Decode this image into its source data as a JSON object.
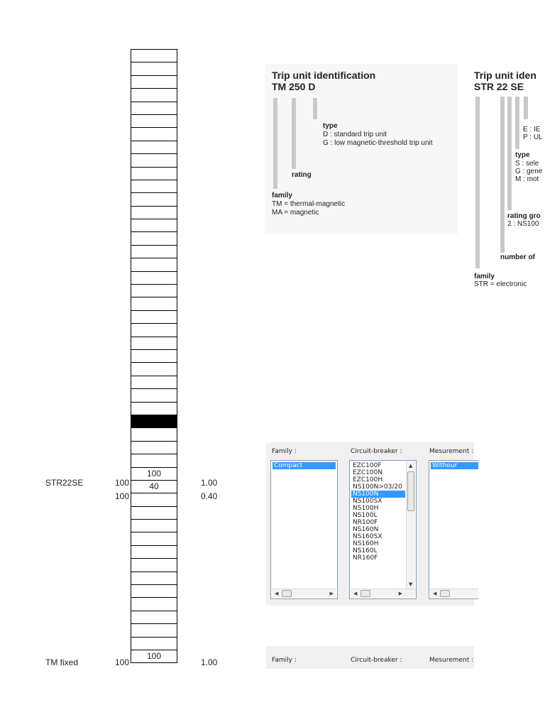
{
  "grid": {
    "rows": [
      {
        "label": "STR22SE",
        "left": "100",
        "cell": "100",
        "right": "1.00"
      },
      {
        "label": "",
        "left": "100",
        "cell": "40",
        "right": "0.40"
      },
      {
        "label": "TM fixed",
        "left": "100",
        "cell": "100",
        "right": "1.00"
      }
    ]
  },
  "diagram_tm": {
    "title": "Trip unit identification",
    "code": "TM 250 D",
    "type_heading": "type",
    "type_d": "D : standard trip unit",
    "type_g": "G : low magnetic-threshold trip unit",
    "rating": "rating",
    "family_heading": "family",
    "family_tm": "TM = thermal-magnetic",
    "family_ma": "MA = magnetic"
  },
  "diagram_str": {
    "title": "Trip unit iden",
    "code": "STR 22 SE",
    "e_line": "E : IE",
    "p_line": "P : UL",
    "type_heading": "type",
    "s_line": "S : sele",
    "g_line": "G : gene",
    "m_line": "M : mot",
    "rating_group": "rating gro",
    "rating_line": "2 : NS100",
    "number_of": "number of",
    "family_heading": "family",
    "family_line": "STR = electronic"
  },
  "panel": {
    "family_label": "Family :",
    "breaker_label": "Circuit-breaker :",
    "measurement_label": "Mesurement :",
    "family_items": [
      "Compact"
    ],
    "breaker_items": [
      "EZC100F",
      "EZC100N",
      "EZC100H",
      "NS100N>03/20",
      "NS100N",
      "NS100SX",
      "NS100H",
      "NS100L",
      "NR100F",
      "NS160N",
      "NS160SX",
      "NS160H",
      "NS160L",
      "NR160F"
    ],
    "breaker_selected": "NS100N",
    "measurement_items": [
      "Withour"
    ]
  },
  "panel2": {
    "family_label": "Family :",
    "breaker_label": "Circuit-breaker :",
    "measurement_label": "Mesurement :"
  }
}
